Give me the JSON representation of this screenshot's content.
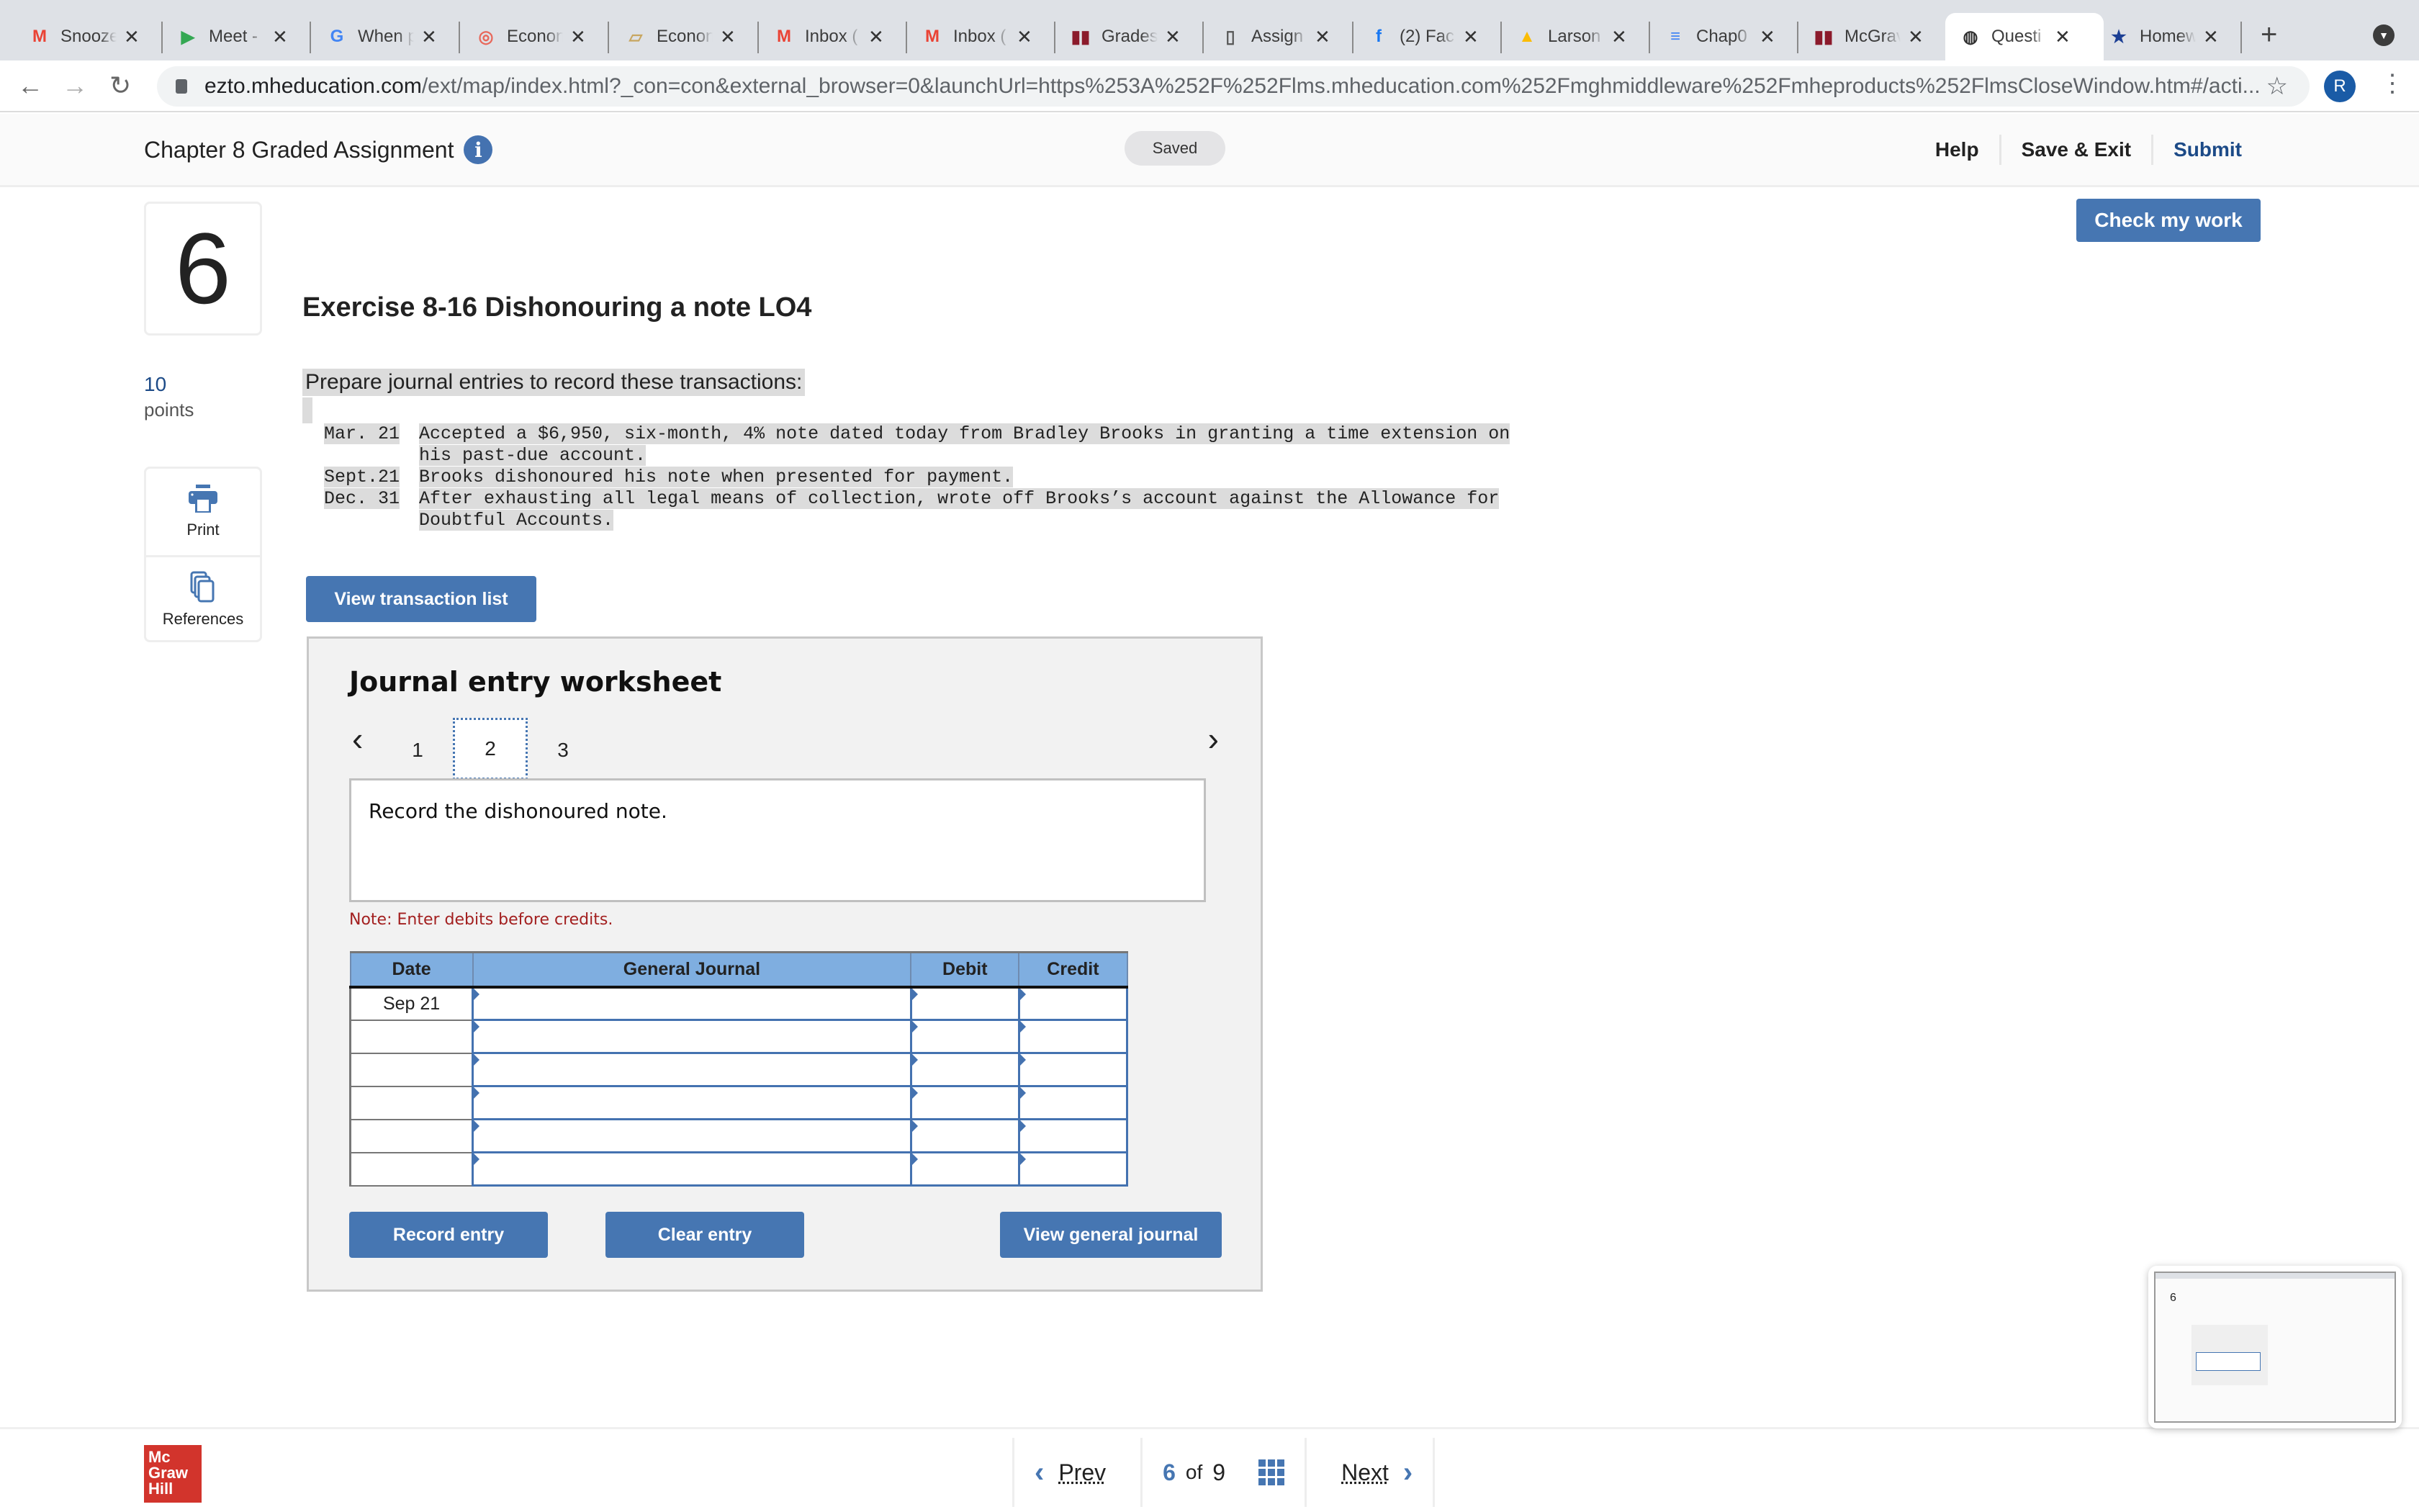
{
  "browser": {
    "tabs": [
      {
        "label": "Snooze",
        "icon": "gmail-icon",
        "color": "#ea4335",
        "glyph": "M"
      },
      {
        "label": "Meet -",
        "icon": "google-meet-icon",
        "color": "#34a853",
        "glyph": "▶"
      },
      {
        "label": "When p",
        "icon": "google-icon",
        "color": "#4285f4",
        "glyph": "G"
      },
      {
        "label": "Econon",
        "icon": "target-icon",
        "color": "#e8675a",
        "glyph": "◎"
      },
      {
        "label": "Econon",
        "icon": "book-icon",
        "color": "#c8a660",
        "glyph": "▱"
      },
      {
        "label": "Inbox (",
        "icon": "gmail-icon",
        "color": "#ea4335",
        "glyph": "M"
      },
      {
        "label": "Inbox (",
        "icon": "gmail-icon",
        "color": "#ea4335",
        "glyph": "M"
      },
      {
        "label": "Grades",
        "icon": "mcgraw-bars-icon",
        "color": "#8b1a2b",
        "glyph": "▮▮"
      },
      {
        "label": "Assign",
        "icon": "document-icon",
        "color": "#555555",
        "glyph": "▯"
      },
      {
        "label": "(2) Fac",
        "icon": "facebook-icon",
        "color": "#1877f2",
        "glyph": "f"
      },
      {
        "label": "Larson",
        "icon": "google-drive-icon",
        "color": "#fbbc04",
        "glyph": "▲"
      },
      {
        "label": "Chap0",
        "icon": "google-docs-icon",
        "color": "#4285f4",
        "glyph": "≡"
      },
      {
        "label": "McGrav",
        "icon": "mcgraw-bars-icon",
        "color": "#8b1a2b",
        "glyph": "▮▮"
      },
      {
        "label": "Questi",
        "icon": "globe-icon",
        "color": "#333333",
        "glyph": "◍",
        "active": true
      },
      {
        "label": "Homew",
        "icon": "shield-star-icon",
        "color": "#1c3f94",
        "glyph": "★"
      }
    ],
    "new_tab": "+",
    "url_host": "ezto.mheducation.com",
    "url_path": "/ext/map/index.html?_con=con&external_browser=0&launchUrl=https%253A%252F%252Flms.mheducation.com%252Fmghmiddleware%252Fmheproducts%252FlmsCloseWindow.htm#/acti...",
    "profile_initial": "R"
  },
  "header": {
    "assignment_title": "Chapter 8 Graded Assignment",
    "info": "i",
    "status": "Saved",
    "help": "Help",
    "save_exit": "Save & Exit",
    "submit": "Submit"
  },
  "question": {
    "check_my_work": "Check my work",
    "number": "6",
    "points_value": "10",
    "points_label": "points",
    "tools": [
      {
        "label": "Print",
        "icon": "printer-icon"
      },
      {
        "label": "References",
        "icon": "references-icon"
      }
    ],
    "title": "Exercise 8-16 Dishonouring a note LO4",
    "prompt": "Prepare journal entries to record these transactions:",
    "transactions": [
      {
        "date": "Mar. 21",
        "lines": [
          "Accepted a $6,950, six-month, 4% note dated today from Bradley Brooks in granting a time extension on",
          "his past-due account."
        ]
      },
      {
        "date": "Sept.21",
        "lines": [
          "Brooks dishonoured his note when presented for payment."
        ]
      },
      {
        "date": "Dec. 31",
        "lines": [
          "After exhausting all legal means of collection, wrote off Brooks’s account against the Allowance for",
          "Doubtful Accounts."
        ]
      }
    ],
    "view_transaction_list": "View transaction list"
  },
  "worksheet": {
    "title": "Journal entry worksheet",
    "tabs": [
      "1",
      "2",
      "3"
    ],
    "active_tab": "2",
    "instruction": "Record the dishonoured note.",
    "note": "Note: Enter debits before credits.",
    "columns": [
      "Date",
      "General Journal",
      "Debit",
      "Credit"
    ],
    "rows": [
      {
        "date": "Sep 21",
        "account": "",
        "debit": "",
        "credit": ""
      },
      {
        "date": "",
        "account": "",
        "debit": "",
        "credit": ""
      },
      {
        "date": "",
        "account": "",
        "debit": "",
        "credit": ""
      },
      {
        "date": "",
        "account": "",
        "debit": "",
        "credit": ""
      },
      {
        "date": "",
        "account": "",
        "debit": "",
        "credit": ""
      },
      {
        "date": "",
        "account": "",
        "debit": "",
        "credit": ""
      }
    ],
    "record_entry": "Record entry",
    "clear_entry": "Clear entry",
    "view_general_journal": "View general journal"
  },
  "footer": {
    "logo_lines": [
      "Mc",
      "Graw",
      "Hill"
    ],
    "prev": "Prev",
    "current": "6",
    "of": "of",
    "total": "9",
    "next": "Next"
  }
}
